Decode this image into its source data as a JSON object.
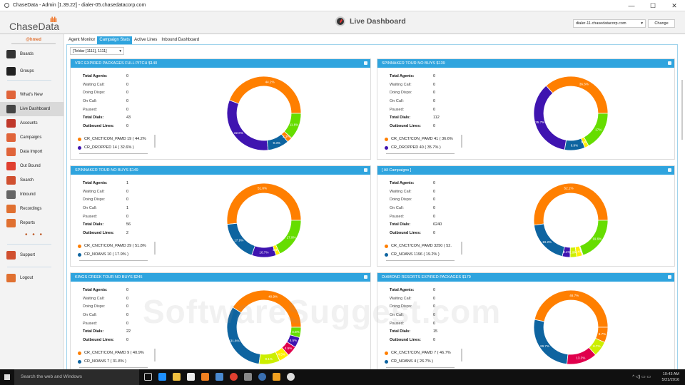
{
  "window": {
    "title": "ChaseData - Admin [1.39.22] - dialer-05.chasedatacorp.com",
    "min": "—",
    "max": "☐",
    "close": "✕"
  },
  "header": {
    "logo": "ChaseData",
    "title": "Live Dashboard",
    "server": "dialer-11.chasedatacorp.com",
    "change": "Change"
  },
  "sidebar": {
    "user": "@hmed",
    "items": [
      {
        "label": "Boards",
        "color": "#333"
      },
      {
        "label": "Groups",
        "color": "#222"
      },
      {
        "label": "What's New",
        "color": "#e0643a"
      },
      {
        "label": "Live Dashboard",
        "color": "#444"
      },
      {
        "label": "Accounts",
        "color": "#c0392b"
      },
      {
        "label": "Campaigns",
        "color": "#e0643a"
      },
      {
        "label": "Data Import",
        "color": "#e0643a"
      },
      {
        "label": "Out Bound",
        "color": "#e04030"
      },
      {
        "label": "Search",
        "color": "#d05030"
      },
      {
        "label": "Inbound",
        "color": "#666"
      },
      {
        "label": "Recordings",
        "color": "#e07030"
      },
      {
        "label": "Reports",
        "color": "#e07030"
      },
      {
        "label": "Support",
        "color": "#d05030"
      },
      {
        "label": "Logout",
        "color": "#e07030"
      }
    ],
    "more": "• • •"
  },
  "tabs": [
    "Agent Monitor",
    "Campaign Stats",
    "Active Lines",
    "Inbound Dashboard"
  ],
  "campaign_filter": "[Teldar [1111], 1111]",
  "stat_labels": [
    "Total Agents:",
    "Waiting Call:",
    "Doing Dispo:",
    "On Call:",
    "Paused:",
    "Total Dials:",
    "Outbound Lines:"
  ],
  "watermark": "SoftwareSuggest.com",
  "colors": {
    "orange": "#ff7f00",
    "purple": "#3f14b0",
    "blue": "#0e64a0",
    "green": "#66dd00",
    "yellow": "#ffee00",
    "lime": "#ccee00",
    "crimson": "#e0004c",
    "header": "#2fa4de"
  },
  "chart_data": [
    {
      "type": "pie",
      "title": "VRC EXPIRED PACKAGES FULL PITCH $140",
      "stats": [
        "0",
        "0",
        "0",
        "0",
        "0",
        "43",
        "0"
      ],
      "legend": [
        "CR_CNCT/CON_PAMD 19 ( 44.2%",
        "CR_DROPPED 14 ( 32.6% )"
      ],
      "legend_colors": [
        "#ff7f00",
        "#3f14b0"
      ],
      "slices": [
        {
          "v": 44.2,
          "c": "#ff7f00",
          "label": "44.2%"
        },
        {
          "v": 32.6,
          "c": "#3f14b0",
          "label": "32.6%"
        },
        {
          "v": 9.3,
          "c": "#0e64a0",
          "label": "9.3%"
        },
        {
          "v": 2.3,
          "c": "#ff7f00",
          "label": "2.3%"
        },
        {
          "v": 11.6,
          "c": "#66dd00",
          "label": "11.6%"
        }
      ]
    },
    {
      "type": "pie",
      "title": "SPINNAKER TOUR NO BUYS $139",
      "stats": [
        "0",
        "0",
        "0",
        "0",
        "0",
        "112",
        "0"
      ],
      "legend": [
        "CR_CNCT/CON_PAMD 41 ( 36.6%",
        "CR_DROPPED 40 ( 35.7% )"
      ],
      "legend_colors": [
        "#ff7f00",
        "#3f14b0"
      ],
      "slices": [
        {
          "v": 36.6,
          "c": "#ff7f00",
          "label": "36.6%"
        },
        {
          "v": 35.7,
          "c": "#3f14b0",
          "label": "35.7%"
        },
        {
          "v": 8.9,
          "c": "#0e64a0",
          "label": "8.9%"
        },
        {
          "v": 1.8,
          "c": "#ffee00",
          "label": "1.8%"
        },
        {
          "v": 17,
          "c": "#66dd00",
          "label": "17%"
        }
      ]
    },
    {
      "type": "pie",
      "title": "SPINNAKER TOUR NO BUYS $149",
      "stats": [
        "1",
        "0",
        "0",
        "1",
        "0",
        "56",
        "2"
      ],
      "legend": [
        "CR_CNCT/CON_PAMD 29 ( 51.8%",
        "CR_NOANS 10 ( 17.9% )"
      ],
      "legend_colors": [
        "#ff7f00",
        "#0e64a0"
      ],
      "slices": [
        {
          "v": 51.8,
          "c": "#ff7f00",
          "label": "51.8%"
        },
        {
          "v": 17.9,
          "c": "#0e64a0",
          "label": "17.9%"
        },
        {
          "v": 10.7,
          "c": "#3f14b0",
          "label": "10.7%"
        },
        {
          "v": 1.8,
          "c": "#ffee00",
          "label": "1.8%"
        },
        {
          "v": 17.9,
          "c": "#66dd00",
          "label": "17.9%"
        }
      ]
    },
    {
      "type": "pie",
      "title": "[ All Campaigns ]",
      "stats": [
        "0",
        "0",
        "0",
        "0",
        "0",
        "6240",
        "0"
      ],
      "legend": [
        "CR_CNCT/CON_PAMD 3250 ( 52.",
        "CR_NOANS 1196 ( 19.2% )"
      ],
      "legend_colors": [
        "#ff7f00",
        "#0e64a0"
      ],
      "slices": [
        {
          "v": 52.1,
          "c": "#ff7f00",
          "label": "52.1%"
        },
        {
          "v": 19.2,
          "c": "#0e64a0",
          "label": "19.2%"
        },
        {
          "v": 3.4,
          "c": "#3f14b0",
          "label": "3.4%"
        },
        {
          "v": 2.9,
          "c": "#ccee00",
          "label": "2.9%"
        },
        {
          "v": 2.4,
          "c": "#ffee00",
          "label": "2.4%"
        },
        {
          "v": 0.3,
          "c": "#e0004c",
          "label": "0.3%"
        },
        {
          "v": 0.1,
          "c": "#ff7f00",
          "label": "0.1%"
        },
        {
          "v": 19.6,
          "c": "#66dd00",
          "label": "19.6%"
        }
      ]
    },
    {
      "type": "pie",
      "title": "KINGS CREEK TOUR NO BUYS $245",
      "stats": [
        "0",
        "0",
        "0",
        "0",
        "0",
        "22",
        "0"
      ],
      "legend": [
        "CR_CNCT/CON_PAMD 9 ( 40.9%",
        "CR_NOANS 7 ( 31.8% )"
      ],
      "legend_colors": [
        "#ff7f00",
        "#0e64a0"
      ],
      "slices": [
        {
          "v": 40.9,
          "c": "#ff7f00",
          "label": "40.9%"
        },
        {
          "v": 31.8,
          "c": "#0e64a0",
          "label": "31.8%"
        },
        {
          "v": 9.1,
          "c": "#ccee00",
          "label": "9.1%"
        },
        {
          "v": 4.5,
          "c": "#ffee00",
          "label": "4.5%"
        },
        {
          "v": 4.5,
          "c": "#e0004c",
          "label": "4.5%"
        },
        {
          "v": 4.5,
          "c": "#3f14b0",
          "label": "4.5%"
        },
        {
          "v": 4.5,
          "c": "#66dd00",
          "label": "4.5%"
        }
      ]
    },
    {
      "type": "pie",
      "title": "DIAMOND RESORTS EXPIRED PACKAGES $179",
      "stats": [
        "0",
        "0",
        "0",
        "0",
        "0",
        "15",
        "0"
      ],
      "legend": [
        "CR_CNCT/CON_PAMD 7 ( 46.7%",
        "CR_NOANS 4 ( 26.7% )"
      ],
      "legend_colors": [
        "#ff7f00",
        "#0e64a0"
      ],
      "slices": [
        {
          "v": 46.7,
          "c": "#ff7f00",
          "label": "46.7%"
        },
        {
          "v": 26.7,
          "c": "#0e64a0",
          "label": "26.7%"
        },
        {
          "v": 13.3,
          "c": "#e0004c",
          "label": "13.3%"
        },
        {
          "v": 6.7,
          "c": "#ccee00",
          "label": "6.7%"
        },
        {
          "v": 6.7,
          "c": "#ff7f00",
          "label": "6.7%"
        }
      ]
    }
  ],
  "taskbar": {
    "search": "Search the web and Windows",
    "time": "10:43 AM",
    "date": "5/21/2016",
    "tray": "^ ◁) ▭ ▭"
  }
}
